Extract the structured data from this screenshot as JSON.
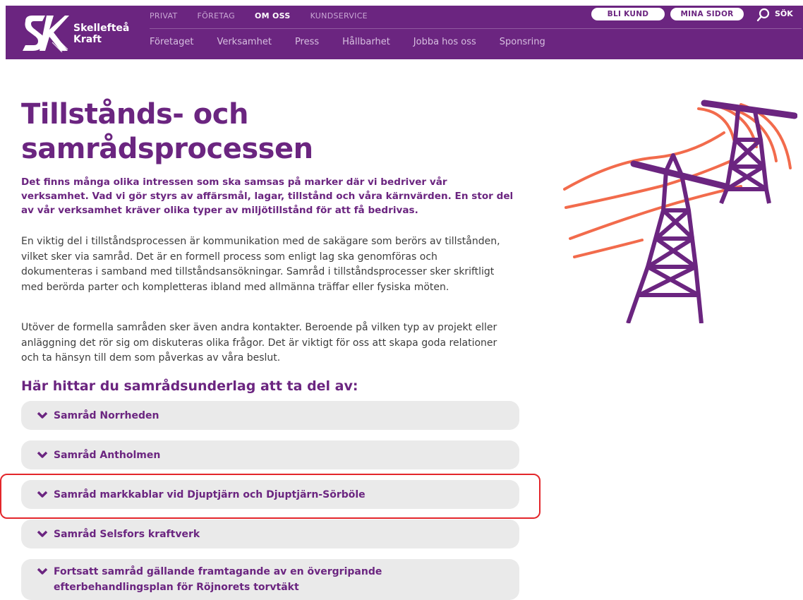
{
  "brand": {
    "line1": "Skellefteå",
    "line2": "Kraft"
  },
  "topnav": [
    "PRIVAT",
    "FÖRETAG",
    "OM OSS",
    "KUNDSERVICE"
  ],
  "topnav_active": "OM OSS",
  "subnav": [
    "Företaget",
    "Verksamhet",
    "Press",
    "Hållbarhet",
    "Jobba hos oss",
    "Sponsring"
  ],
  "actions": {
    "bli_kund": "BLI KUND",
    "mina_sidor": "MINA SIDOR",
    "search": "SÖK"
  },
  "page": {
    "title_line1": "Tillstånds- och",
    "title_line2": "samrådsprocessen",
    "lead": "Det finns många olika intressen som ska samsas på marker där vi bedriver vår verksamhet. Vad vi gör styrs av affärsmål, lagar, tillstånd och våra kärnvärden. En stor del av vår verksamhet kräver olika typer av miljötillstånd för att få bedrivas.",
    "para1": "En viktig del i tillståndsprocessen är kommunikation med de sakägare som berörs av tillstånden, vilket sker via samråd. Det är en formell process som enligt lag ska genomföras och dokumenteras i samband med tillståndsansökningar. Samråd i tillståndsprocesser sker skriftligt med berörda parter och kompletteras ibland med allmänna träffar eller fysiska möten.",
    "para2": "Utöver de formella samråden sker även andra kontakter. Beroende på vilken typ av projekt eller anläggning det rör sig om diskuteras olika frågor. Det är viktigt för oss att skapa goda relationer och ta hänsyn till dem som påverkas av våra beslut.",
    "section_heading": "Här hittar du samrådsunderlag att ta del av:"
  },
  "accordion": [
    "Samråd Norrheden",
    "Samråd Antholmen",
    "Samråd markkablar vid Djuptjärn och Djuptjärn-Sörböle",
    "Samråd Selsfors kraftverk",
    "Fortsatt samråd gällande framtagande av en övergripande efterbehandlingsplan för Röjnorets torvtäkt"
  ],
  "highlighted_item": "Samråd markkablar vid Djuptjärn och Djuptjärn-Sörböle",
  "colors": {
    "brand_purple": "#6b2580",
    "accent_orange": "#f26b4c",
    "highlight_red": "#e3262b",
    "accordion_bg": "#eaeaea"
  },
  "icons": [
    "logo-mark",
    "search-icon",
    "chevron-down-icon",
    "power-pylon-illustration"
  ]
}
